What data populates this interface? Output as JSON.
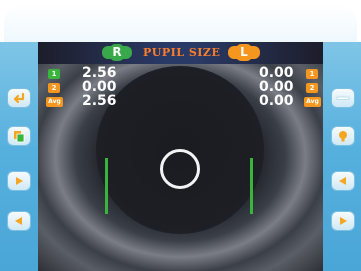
{
  "screen": {
    "title": "PUPIL SIZE",
    "right_eye_label": "R",
    "left_eye_label": "L"
  },
  "right_measurements": [
    {
      "badge": "1",
      "value": "2.56"
    },
    {
      "badge": "2",
      "value": "0.00"
    },
    {
      "badge": "Avg",
      "value": "2.56"
    }
  ],
  "left_measurements": [
    {
      "badge": "1",
      "value": "0.00"
    },
    {
      "badge": "2",
      "value": "0.00"
    },
    {
      "badge": "Avg",
      "value": "0.00"
    }
  ],
  "left_buttons": [
    {
      "icon": "return-icon"
    },
    {
      "icon": "copy-icon"
    },
    {
      "icon": "play-right-icon"
    },
    {
      "icon": "play-left-icon"
    }
  ],
  "right_buttons": [
    {
      "icon": "minus-icon"
    },
    {
      "icon": "lightbulb-icon"
    },
    {
      "icon": "play-left-icon"
    },
    {
      "icon": "play-right-icon"
    }
  ],
  "colors": {
    "title": "#ff7d2a",
    "right_eye": "#38a84a",
    "left_eye": "#f5961e",
    "bezel": "#56b0de"
  }
}
